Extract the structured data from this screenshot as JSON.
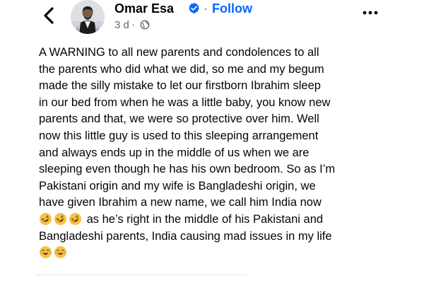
{
  "header": {
    "back_icon": "chevron-left-icon",
    "avatar_alt": "profile photo",
    "name": "Omar Esa",
    "verified_icon": "verified-badge-icon",
    "separator": "·",
    "follow_label": "Follow",
    "time": "3 d",
    "meta_separator": "·",
    "audience_icon": "globe-icon",
    "more_icon": "more-horizontal-icon"
  },
  "post": {
    "lines": [
      "A WARNING to all new parents and condolences to all",
      "the parents who did what we did, so me and my begum",
      "made the silly mistake to let our firstborn Ibrahim sleep",
      "in our bed from when he was a little baby, you know new",
      "parents and that, we were so protective over him. Well",
      "now this little guy is used to this sleeping arrangement",
      "and always ends up in the middle of us when we are",
      "sleeping even though he has his own bedroom. So as I’m",
      "Pakistani origin and my wife is Bangladeshi origin, we",
      "have given Ibrahim a new name, we call him India now"
    ],
    "line_after_emoji": "as he’s right in the middle of his Pakistani and",
    "line_12": "Bangladeshi parents, India causing mad issues in my life",
    "emoji_laughing": "rolling-on-floor-laughing-emoji",
    "emoji_crying": "crying-laughing-emoji"
  },
  "colors": {
    "accent": "#0866ff",
    "text": "#050505",
    "secondary": "#65676b",
    "verified": "#0866ff",
    "emoji_face": "#f7c341"
  }
}
